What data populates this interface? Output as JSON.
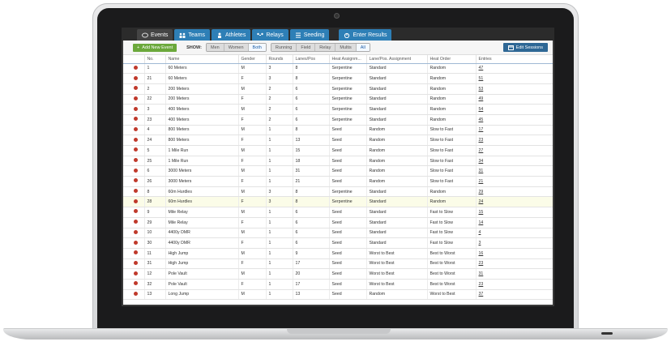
{
  "tabs": [
    {
      "label": "Events",
      "icon": "events-icon",
      "active": true
    },
    {
      "label": "Teams",
      "icon": "teams-icon"
    },
    {
      "label": "Athletes",
      "icon": "athlete-icon"
    },
    {
      "label": "Relays",
      "icon": "relay-icon"
    },
    {
      "label": "Seeding",
      "icon": "seeding-icon"
    },
    {
      "label": "Enter Results",
      "icon": "results-icon"
    }
  ],
  "toolbar": {
    "add_label": "Add New Event",
    "show_label": "SHOW:",
    "gender_filters": [
      "Men",
      "Women",
      "Both"
    ],
    "gender_selected": "Both",
    "type_filters": [
      "Running",
      "Field",
      "Relay",
      "Multis",
      "All"
    ],
    "type_selected": "All",
    "sessions_label": "Edit Sessions"
  },
  "columns": [
    "",
    "No.",
    "Name",
    "Gender",
    "Rounds",
    "Lanes/Pos",
    "Heat Assignm...",
    "Lane/Pos. Assignment",
    "Heat Order",
    "Entries"
  ],
  "rows": [
    [
      "1",
      "60 Meters",
      "M",
      "3",
      "8",
      "Serpentine",
      "Standard",
      "Random",
      "47"
    ],
    [
      "21",
      "60 Meters",
      "F",
      "3",
      "8",
      "Serpentine",
      "Standard",
      "Random",
      "51"
    ],
    [
      "2",
      "200 Meters",
      "M",
      "2",
      "6",
      "Serpentine",
      "Standard",
      "Random",
      "53"
    ],
    [
      "22",
      "200 Meters",
      "F",
      "2",
      "6",
      "Serpentine",
      "Standard",
      "Random",
      "49"
    ],
    [
      "3",
      "400 Meters",
      "M",
      "2",
      "6",
      "Serpentine",
      "Standard",
      "Random",
      "54"
    ],
    [
      "23",
      "400 Meters",
      "F",
      "2",
      "6",
      "Serpentine",
      "Standard",
      "Random",
      "45"
    ],
    [
      "4",
      "800 Meters",
      "M",
      "1",
      "8",
      "Seed",
      "Random",
      "Slow to Fast",
      "17"
    ],
    [
      "24",
      "800 Meters",
      "F",
      "1",
      "13",
      "Seed",
      "Random",
      "Slow to Fast",
      "23"
    ],
    [
      "5",
      "1 Mile Run",
      "M",
      "1",
      "15",
      "Seed",
      "Random",
      "Slow to Fast",
      "27"
    ],
    [
      "25",
      "1 Mile Run",
      "F",
      "1",
      "18",
      "Seed",
      "Random",
      "Slow to Fast",
      "34"
    ],
    [
      "6",
      "3000 Meters",
      "M",
      "1",
      "31",
      "Seed",
      "Random",
      "Slow to Fast",
      "31"
    ],
    [
      "26",
      "3000 Meters",
      "F",
      "1",
      "21",
      "Seed",
      "Random",
      "Slow to Fast",
      "21"
    ],
    [
      "8",
      "60m Hurdles",
      "M",
      "3",
      "8",
      "Serpentine",
      "Standard",
      "Random",
      "29"
    ],
    [
      "28",
      "60m Hurdles",
      "F",
      "3",
      "8",
      "Serpentine",
      "Standard",
      "Random",
      "24"
    ],
    [
      "9",
      "Mile Relay",
      "M",
      "1",
      "6",
      "Seed",
      "Standard",
      "Fast to Slow",
      "15"
    ],
    [
      "29",
      "Mile Relay",
      "F",
      "1",
      "6",
      "Seed",
      "Standard",
      "Fast to Slow",
      "14"
    ],
    [
      "10",
      "4400y DMR",
      "M",
      "1",
      "6",
      "Seed",
      "Standard",
      "Fast to Slow",
      "4"
    ],
    [
      "30",
      "4400y DMR",
      "F",
      "1",
      "6",
      "Seed",
      "Standard",
      "Fast to Slow",
      "3"
    ],
    [
      "11",
      "High Jump",
      "M",
      "1",
      "9",
      "Seed",
      "Worst to Best",
      "Best to Worst",
      "16"
    ],
    [
      "31",
      "High Jump",
      "F",
      "1",
      "17",
      "Seed",
      "Worst to Best",
      "Best to Worst",
      "23"
    ],
    [
      "12",
      "Pole Vault",
      "M",
      "1",
      "20",
      "Seed",
      "Worst to Best",
      "Best to Worst",
      "31"
    ],
    [
      "32",
      "Pole Vault",
      "F",
      "1",
      "17",
      "Seed",
      "Worst to Best",
      "Best to Worst",
      "23"
    ],
    [
      "13",
      "Long Jump",
      "M",
      "1",
      "13",
      "Seed",
      "Random",
      "Worst to Best",
      "37"
    ]
  ],
  "highlight_row": 13,
  "colors": {
    "tab_blue": "#2e7fb6",
    "add_green": "#6ba83b",
    "delete_red": "#c0392b",
    "sessions_blue": "#2e6795"
  }
}
